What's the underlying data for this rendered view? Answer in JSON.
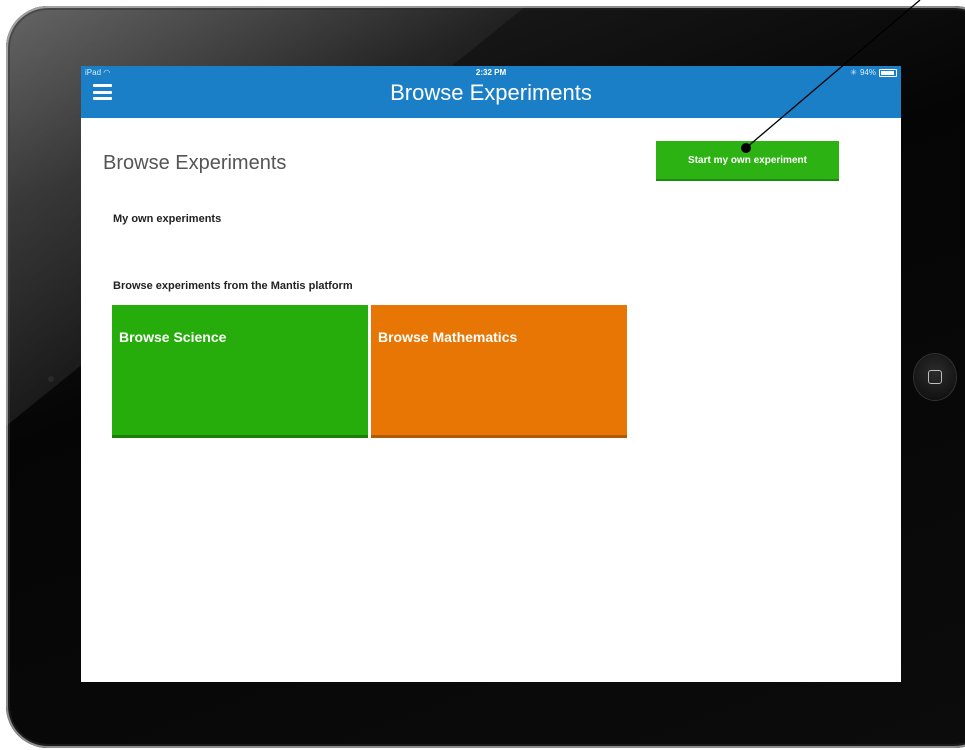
{
  "status_bar": {
    "carrier": "iPad",
    "time": "2:32 PM",
    "battery": "94%",
    "battery_level": 0.94
  },
  "navbar": {
    "title": "Browse Experiments",
    "menu_icon": "hamburger-menu-icon"
  },
  "page": {
    "heading": "Browse Experiments",
    "start_button_label": "Start my own experiment",
    "own_section_label": "My own experiments",
    "browse_section_label": "Browse experiments from the Mantis platform",
    "tiles": [
      {
        "label": "Browse Science",
        "color": "#26ad0b"
      },
      {
        "label": "Browse Mathematics",
        "color": "#e87604"
      }
    ]
  },
  "colors": {
    "navbar": "#1a7fc7",
    "start_button": "#2db214"
  }
}
